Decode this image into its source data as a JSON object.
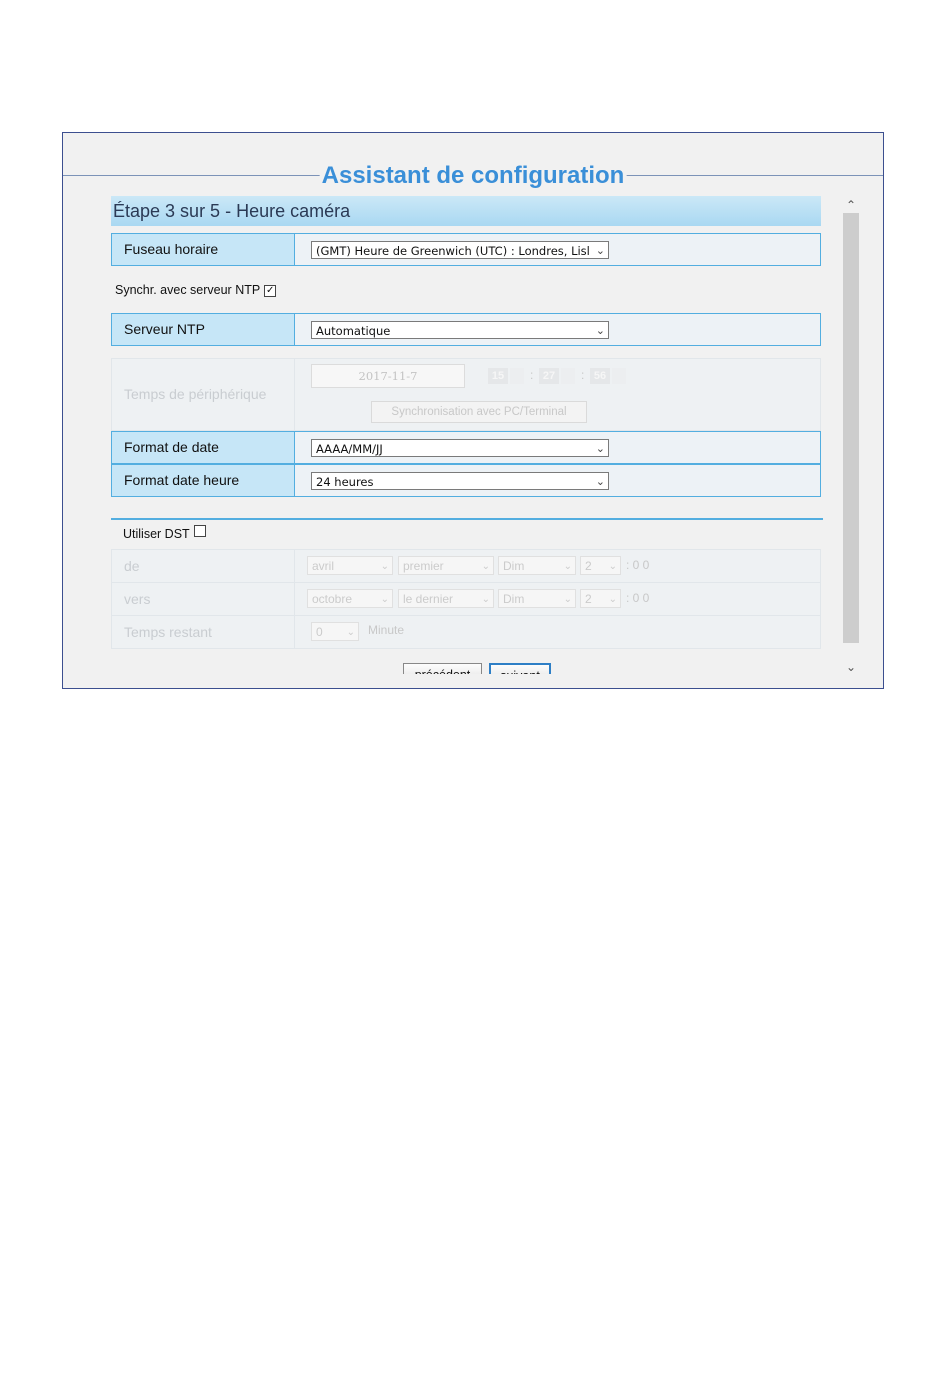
{
  "wizard": {
    "title": "Assistant de configuration",
    "step_header": "Étape 3 sur 5 - Heure caméra"
  },
  "timezone": {
    "label": "Fuseau horaire",
    "value": "(GMT) Heure de Greenwich (UTC) : Londres, Lisl"
  },
  "ntp_sync": {
    "label": "Synchr. avec serveur NTP",
    "checked": true,
    "check_mark": "☑"
  },
  "ntp_server": {
    "label": "Serveur NTP",
    "value": "Automatique"
  },
  "device_time": {
    "label": "Temps de périphérique",
    "date": "2017-11-7",
    "hour": "15",
    "minute": "27",
    "second": "56",
    "separator": ":",
    "sync_button": "Synchronisation avec PC/Terminal"
  },
  "date_format": {
    "label": "Format de date",
    "value": "AAAA/MM/JJ"
  },
  "time_format": {
    "label": "Format date heure",
    "value": "24 heures"
  },
  "dst": {
    "label": "Utiliser DST",
    "checked": false,
    "from": {
      "label": "de",
      "month": "avril",
      "week": "premier",
      "day": "Dim",
      "hour": "2",
      "suffix": ": 0 0"
    },
    "to": {
      "label": "vers",
      "month": "octobre",
      "week": "le dernier",
      "day": "Dim",
      "hour": "2",
      "suffix": ": 0 0"
    },
    "remaining": {
      "label": "Temps restant",
      "value": "0",
      "unit": "Minute"
    }
  },
  "buttons": {
    "previous": "précédent",
    "next": "suivant"
  },
  "icons": {
    "chevron": "chevron-down-icon",
    "scroll_up": "scroll-up-icon",
    "scroll_down": "scroll-down-icon"
  },
  "colors": {
    "title": "#3a8fd8",
    "row_border": "#53aee0",
    "label_bg": "#c6e6f7"
  }
}
